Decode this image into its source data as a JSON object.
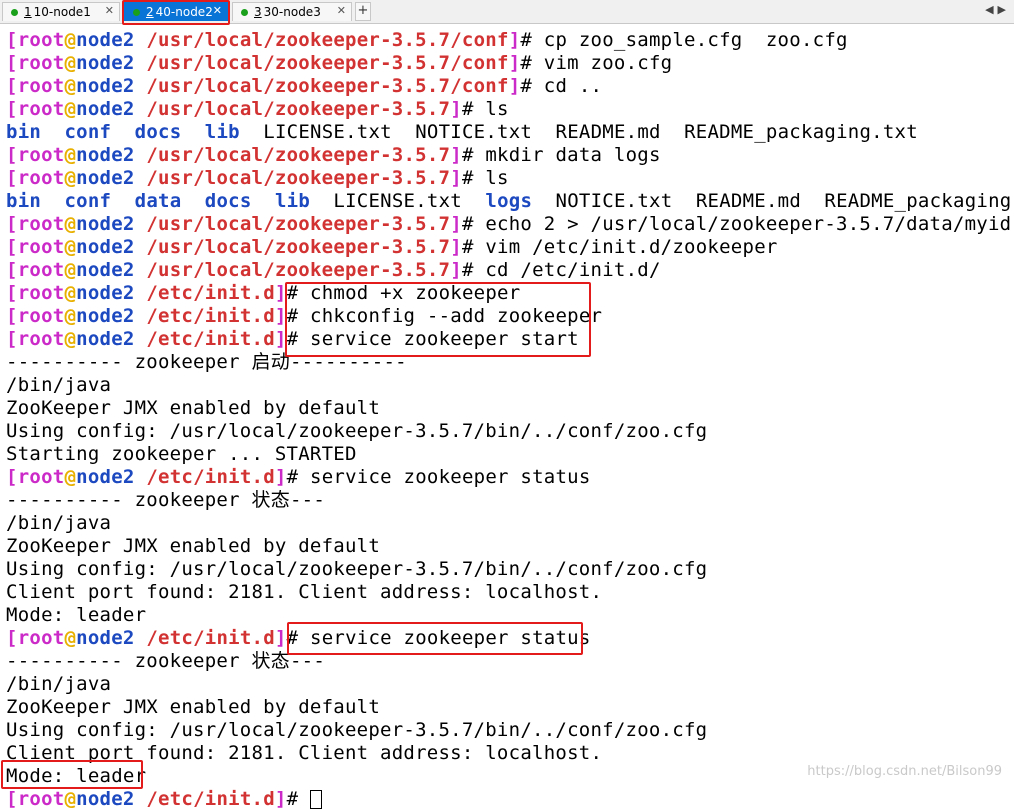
{
  "tabs": [
    {
      "number": "1",
      "label": "10-node1",
      "active": false
    },
    {
      "number": "2",
      "label": "40-node2",
      "active": true
    },
    {
      "number": "3",
      "label": "30-node3",
      "active": false
    }
  ],
  "add_tab_label": "+",
  "prompt": {
    "user": "root",
    "at": "@",
    "host": "node2"
  },
  "lines": [
    {
      "type": "prompt",
      "path": "/usr/local/zookeeper-3.5.7/conf",
      "cmd": "cp zoo_sample.cfg  zoo.cfg"
    },
    {
      "type": "prompt",
      "path": "/usr/local/zookeeper-3.5.7/conf",
      "cmd": "vim zoo.cfg"
    },
    {
      "type": "prompt",
      "path": "/usr/local/zookeeper-3.5.7/conf",
      "cmd": "cd .."
    },
    {
      "type": "prompt",
      "path": "/usr/local/zookeeper-3.5.7",
      "cmd": "ls"
    },
    {
      "type": "ls",
      "items": [
        {
          "t": "bin",
          "dir": true
        },
        {
          "t": "conf",
          "dir": true
        },
        {
          "t": "docs",
          "dir": true
        },
        {
          "t": "lib",
          "dir": true
        },
        {
          "t": "LICENSE.txt",
          "dir": false
        },
        {
          "t": "NOTICE.txt",
          "dir": false
        },
        {
          "t": "README.md",
          "dir": false
        },
        {
          "t": "README_packaging.txt",
          "dir": false
        }
      ]
    },
    {
      "type": "prompt",
      "path": "/usr/local/zookeeper-3.5.7",
      "cmd": "mkdir data logs"
    },
    {
      "type": "prompt",
      "path": "/usr/local/zookeeper-3.5.7",
      "cmd": "ls"
    },
    {
      "type": "ls",
      "items": [
        {
          "t": "bin",
          "dir": true
        },
        {
          "t": "conf",
          "dir": true
        },
        {
          "t": "data",
          "dir": true
        },
        {
          "t": "docs",
          "dir": true
        },
        {
          "t": "lib",
          "dir": true
        },
        {
          "t": "LICENSE.txt",
          "dir": false
        },
        {
          "t": "logs",
          "dir": true
        },
        {
          "t": "NOTICE.txt",
          "dir": false
        },
        {
          "t": "README.md",
          "dir": false
        },
        {
          "t": "README_packaging.txt",
          "dir": false
        }
      ]
    },
    {
      "type": "prompt",
      "path": "/usr/local/zookeeper-3.5.7",
      "cmd": "echo 2 > /usr/local/zookeeper-3.5.7/data/myid"
    },
    {
      "type": "prompt",
      "path": "/usr/local/zookeeper-3.5.7",
      "cmd": "vim /etc/init.d/zookeeper"
    },
    {
      "type": "prompt",
      "path": "/usr/local/zookeeper-3.5.7",
      "cmd": "cd /etc/init.d/"
    },
    {
      "type": "prompt",
      "path": "/etc/init.d",
      "cmd": "chmod +x zookeeper"
    },
    {
      "type": "prompt",
      "path": "/etc/init.d",
      "cmd": "chkconfig --add zookeeper"
    },
    {
      "type": "prompt",
      "path": "/etc/init.d",
      "cmd": "service zookeeper start"
    },
    {
      "type": "text",
      "text": "---------- zookeeper 启动----------"
    },
    {
      "type": "text",
      "text": "/bin/java"
    },
    {
      "type": "text",
      "text": "ZooKeeper JMX enabled by default"
    },
    {
      "type": "text",
      "text": "Using config: /usr/local/zookeeper-3.5.7/bin/../conf/zoo.cfg"
    },
    {
      "type": "text",
      "text": "Starting zookeeper ... STARTED"
    },
    {
      "type": "prompt",
      "path": "/etc/init.d",
      "cmd": "service zookeeper status"
    },
    {
      "type": "text",
      "text": "---------- zookeeper 状态---"
    },
    {
      "type": "text",
      "text": "/bin/java"
    },
    {
      "type": "text",
      "text": "ZooKeeper JMX enabled by default"
    },
    {
      "type": "text",
      "text": "Using config: /usr/local/zookeeper-3.5.7/bin/../conf/zoo.cfg"
    },
    {
      "type": "text",
      "text": "Client port found: 2181. Client address: localhost."
    },
    {
      "type": "text",
      "text": "Mode: leader"
    },
    {
      "type": "prompt",
      "path": "/etc/init.d",
      "cmd": "service zookeeper status"
    },
    {
      "type": "text",
      "text": "---------- zookeeper 状态---"
    },
    {
      "type": "text",
      "text": "/bin/java"
    },
    {
      "type": "text",
      "text": "ZooKeeper JMX enabled by default"
    },
    {
      "type": "text",
      "text": "Using config: /usr/local/zookeeper-3.5.7/bin/../conf/zoo.cfg"
    },
    {
      "type": "text",
      "text": "Client port found: 2181. Client address: localhost."
    },
    {
      "type": "text",
      "text": "Mode: leader"
    }
  ],
  "watermark": "https://blog.csdn.net/Bilson99",
  "colors": {
    "prompt_bracket": "#cc2ac8",
    "host": "#1c48c0",
    "at": "#e8b000",
    "path": "#d23232",
    "directory": "#1c48c0",
    "highlight": "#e31b1b",
    "active_tab": "#0a74d6"
  }
}
